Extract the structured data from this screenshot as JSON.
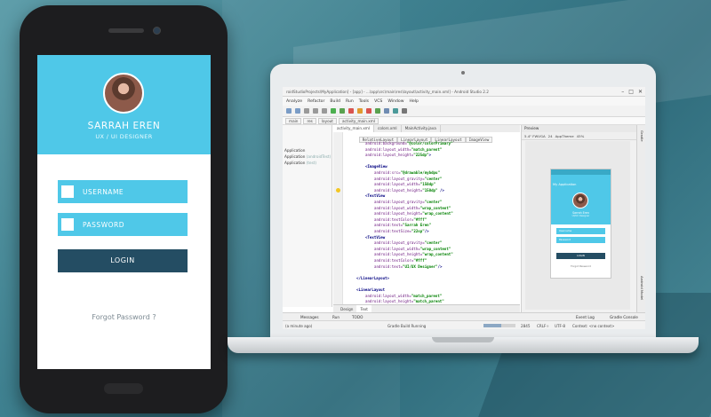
{
  "phone_app": {
    "user_name": "SARRAH EREN",
    "user_role": "UX / UI DESIGNER",
    "username_placeholder": "USERNAME",
    "password_placeholder": "PASSWORD",
    "login_label": "LOGIN",
    "forgot_label": "Forgot Password ?",
    "accent_color": "#4fc8e8",
    "button_color": "#244d63"
  },
  "ide": {
    "window_title": "roidStudioProjects\\MyApplication] - [app] - ...\\app\\src\\main\\res\\layout\\activity_main.xml] - Android Studio 2.2",
    "menu": [
      "Analyze",
      "Refactor",
      "Build",
      "Run",
      "Tools",
      "VCS",
      "Window",
      "Help"
    ],
    "nav_crumbs": [
      "main",
      "res",
      "layout",
      "activity_main.xml"
    ],
    "editor_tabs": [
      "activity_main.xml",
      "colors.xml",
      "MainActivity.java"
    ],
    "xml_breadcrumbs": [
      "RelativeLayout",
      "LinearLayout",
      "LinearLayout",
      "ImageView"
    ],
    "project_rows": [
      {
        "text": "Application",
        "hint": ""
      },
      {
        "text": "Application",
        "hint": "(androidTest)"
      },
      {
        "text": "Application",
        "hint": "(test)"
      }
    ],
    "code_lines": [
      {
        "indent": 8,
        "parts": [
          [
            "attr",
            "android:background="
          ],
          [
            "val",
            "\"@color/colorPrimary\""
          ]
        ]
      },
      {
        "indent": 8,
        "parts": [
          [
            "attr",
            "android:layout_width="
          ],
          [
            "val",
            "\"match_parent\""
          ]
        ]
      },
      {
        "indent": 8,
        "parts": [
          [
            "attr",
            "android:layout_height="
          ],
          [
            "val",
            "\"225dp\""
          ],
          [
            "tag",
            ">"
          ]
        ]
      },
      {
        "indent": 0,
        "parts": []
      },
      {
        "indent": 8,
        "parts": [
          [
            "tag",
            "<ImageView"
          ]
        ]
      },
      {
        "indent": 12,
        "parts": [
          [
            "attr",
            "android:src="
          ],
          [
            "val",
            "\"@drawable/mybdpu\""
          ]
        ]
      },
      {
        "indent": 12,
        "parts": [
          [
            "attr",
            "android:layout_gravity="
          ],
          [
            "val",
            "\"center\""
          ]
        ]
      },
      {
        "indent": 12,
        "parts": [
          [
            "attr",
            "android:layout_width="
          ],
          [
            "val",
            "\"150dp\""
          ]
        ]
      },
      {
        "indent": 12,
        "parts": [
          [
            "attr",
            "android:layout_height="
          ],
          [
            "val",
            "\"150dp\""
          ],
          [
            "tag",
            " />"
          ]
        ]
      },
      {
        "indent": 8,
        "parts": [
          [
            "tag",
            "<TextView"
          ]
        ]
      },
      {
        "indent": 12,
        "parts": [
          [
            "attr",
            "android:layout_gravity="
          ],
          [
            "val",
            "\"center\""
          ]
        ]
      },
      {
        "indent": 12,
        "parts": [
          [
            "attr",
            "android:layout_width="
          ],
          [
            "val",
            "\"wrap_content\""
          ]
        ]
      },
      {
        "indent": 12,
        "parts": [
          [
            "attr",
            "android:layout_height="
          ],
          [
            "val",
            "\"wrap_content\""
          ]
        ]
      },
      {
        "indent": 12,
        "parts": [
          [
            "attr",
            "android:textColor="
          ],
          [
            "val",
            "\"#fff\""
          ]
        ]
      },
      {
        "indent": 12,
        "parts": [
          [
            "attr",
            "android:text="
          ],
          [
            "val",
            "\"Sarrah Eren\""
          ]
        ]
      },
      {
        "indent": 12,
        "parts": [
          [
            "attr",
            "android:textSize="
          ],
          [
            "val",
            "\"22sp\""
          ],
          [
            "tag",
            "/>"
          ]
        ]
      },
      {
        "indent": 8,
        "parts": [
          [
            "tag",
            "<TextView"
          ]
        ]
      },
      {
        "indent": 12,
        "parts": [
          [
            "attr",
            "android:layout_gravity="
          ],
          [
            "val",
            "\"center\""
          ]
        ]
      },
      {
        "indent": 12,
        "parts": [
          [
            "attr",
            "android:layout_width="
          ],
          [
            "val",
            "\"wrap_content\""
          ]
        ]
      },
      {
        "indent": 12,
        "parts": [
          [
            "attr",
            "android:layout_height="
          ],
          [
            "val",
            "\"wrap_content\""
          ]
        ]
      },
      {
        "indent": 12,
        "parts": [
          [
            "attr",
            "android:textColor="
          ],
          [
            "val",
            "\"#fff\""
          ]
        ]
      },
      {
        "indent": 12,
        "parts": [
          [
            "attr",
            "android:text="
          ],
          [
            "val",
            "\"UI/UX Designer\""
          ],
          [
            "tag",
            "/>"
          ]
        ]
      },
      {
        "indent": 0,
        "parts": []
      },
      {
        "indent": 4,
        "parts": [
          [
            "tag",
            "</LinearLayout>"
          ]
        ]
      },
      {
        "indent": 0,
        "parts": []
      },
      {
        "indent": 4,
        "parts": [
          [
            "tag",
            "<LinearLayout"
          ]
        ]
      },
      {
        "indent": 8,
        "parts": [
          [
            "attr",
            "android:layout_width="
          ],
          [
            "val",
            "\"match_parent\""
          ]
        ]
      },
      {
        "indent": 8,
        "parts": [
          [
            "attr",
            "android:layout_height="
          ],
          [
            "val",
            "\"match_parent\""
          ]
        ]
      }
    ],
    "design_tabs": [
      "Design",
      "Text"
    ],
    "preview": {
      "panel_title": "Preview",
      "device": "5.4\" FWVGA",
      "api": "24",
      "theme": "AppTheme",
      "zoom": "45%",
      "app_title": "My Application",
      "name": "Sarrah Eren",
      "role": "UI/UX Designer",
      "field1": "Username",
      "field2": "Password",
      "button": "LOGIN",
      "forgot": "Forgot Password"
    },
    "right_tools": [
      "Gradle",
      "Android Model"
    ],
    "bottom_tools": [
      "Messages",
      "Run",
      "TODO",
      "Event Log",
      "Gradle Console"
    ],
    "status": {
      "left": "(a minute ago)",
      "center": "Gradle Build Running",
      "position": "2845",
      "line_sep": "CRLF÷",
      "encoding": "UTF-8",
      "context": "Context: <no context>",
      "progress": 0.55
    }
  }
}
